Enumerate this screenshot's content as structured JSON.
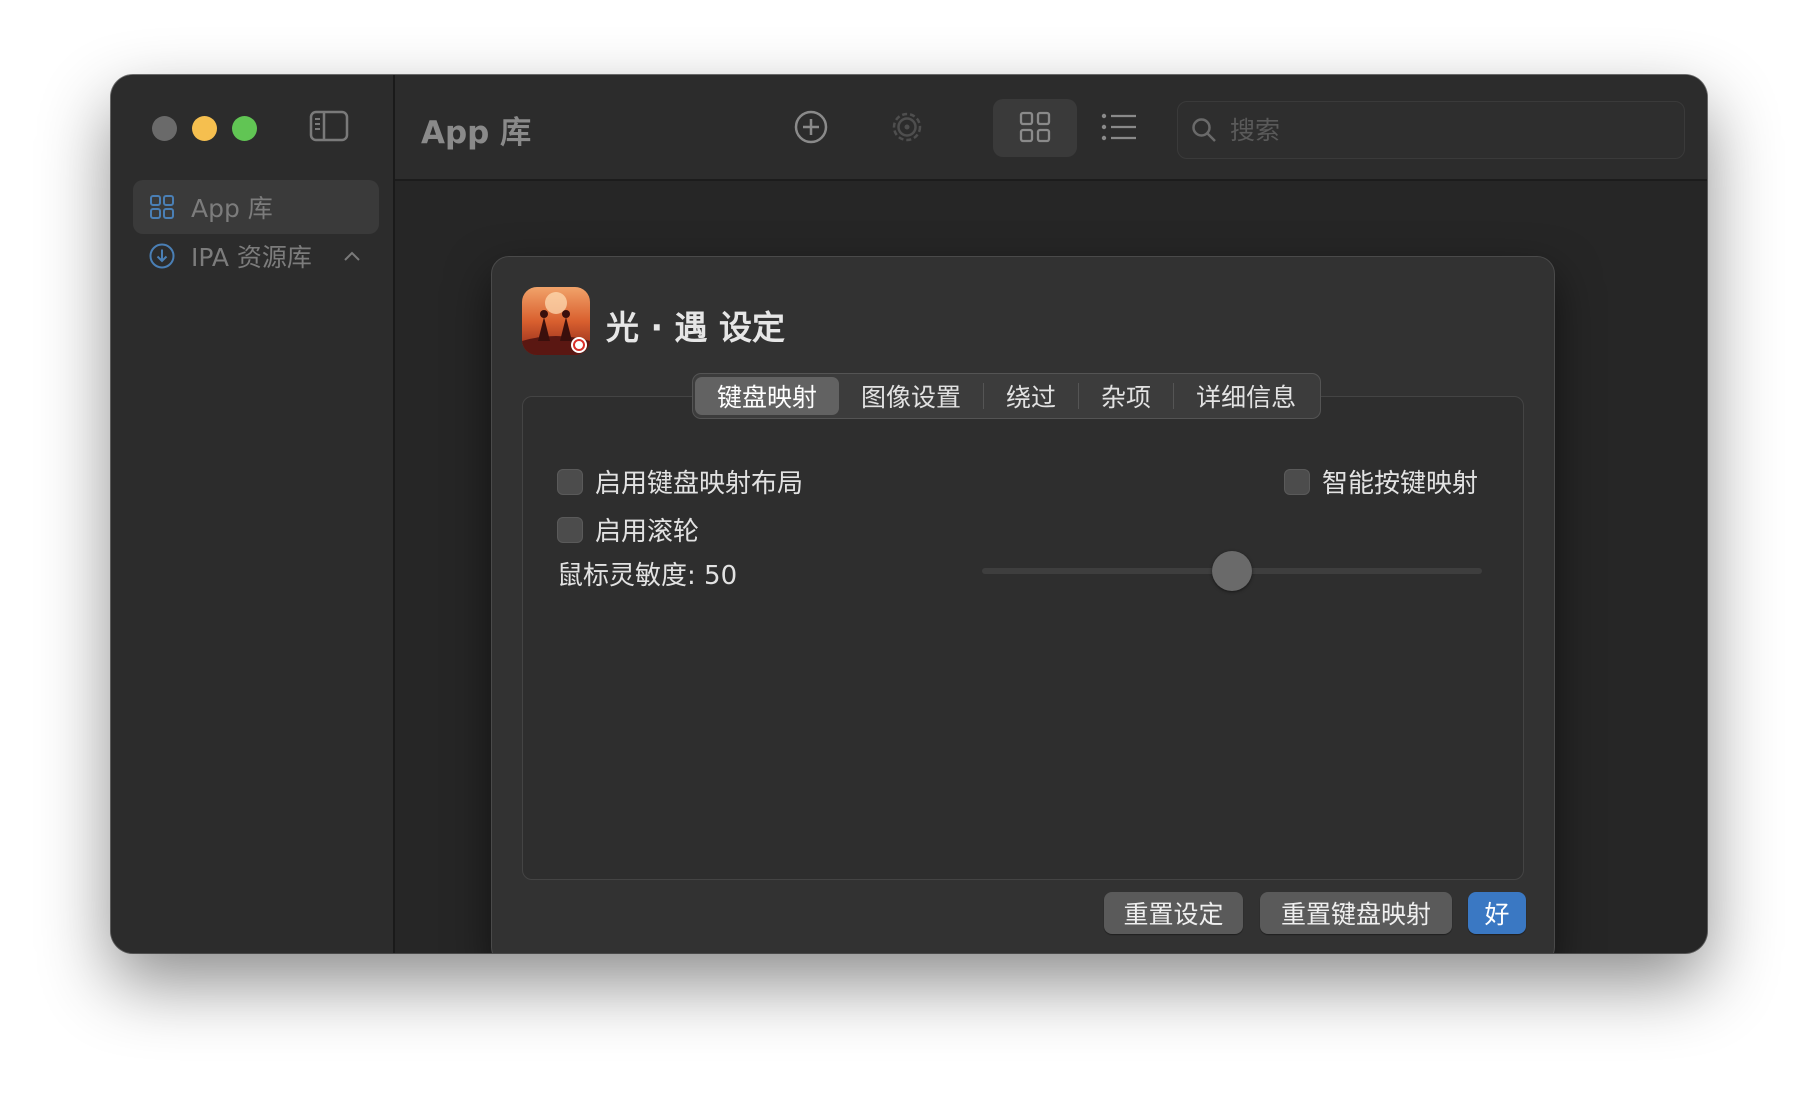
{
  "toolbar": {
    "title": "App 库",
    "search_placeholder": "搜索"
  },
  "sidebar": {
    "items": [
      {
        "label": "App 库",
        "icon": "grid-icon",
        "active": true
      },
      {
        "label": "IPA 资源库",
        "icon": "download-circle-icon",
        "active": false
      }
    ]
  },
  "dialog": {
    "title": "光 · 遇 设定",
    "tabs": [
      "键盘映射",
      "图像设置",
      "绕过",
      "杂项",
      "详细信息"
    ],
    "active_tab": 0,
    "options": {
      "enable_keymap": {
        "label": "启用键盘映射布局",
        "checked": false
      },
      "smart_keymap": {
        "label": "智能按键映射",
        "checked": false
      },
      "enable_scroll": {
        "label": "启用滚轮",
        "checked": false
      }
    },
    "sensitivity": {
      "label": "鼠标灵敏度: 50",
      "value": 50,
      "min": 0,
      "max": 100
    },
    "buttons": {
      "reset_settings": "重置设定",
      "reset_keymap": "重置键盘映射",
      "ok": "好"
    }
  },
  "colors": {
    "accent": "#3a78c3",
    "traffic_close": "#6a6a6a",
    "traffic_minimize": "#f5bf4f",
    "traffic_maximize": "#61c554"
  }
}
